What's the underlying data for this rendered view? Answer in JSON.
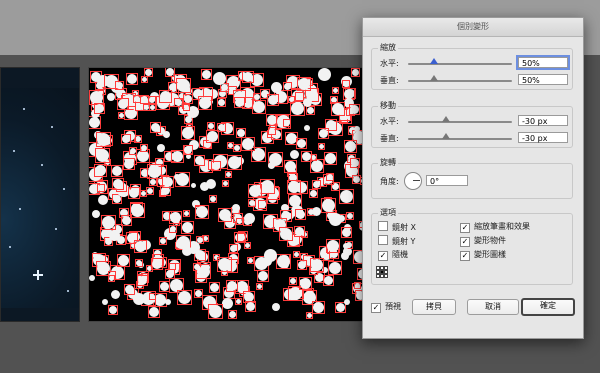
{
  "dialog": {
    "title": "個別變形",
    "scale": {
      "label": "縮放",
      "horizontal_label": "水平:",
      "horizontal_value": "50%",
      "vertical_label": "垂直:",
      "vertical_value": "50%"
    },
    "move": {
      "label": "移動",
      "horizontal_label": "水平:",
      "horizontal_value": "-30 px",
      "vertical_label": "垂直:",
      "vertical_value": "-30 px"
    },
    "rotate": {
      "label": "旋轉",
      "angle_label": "角度:",
      "angle_value": "0°"
    },
    "options": {
      "label": "選項",
      "reflect_x": {
        "label": "鏡射 X",
        "checked": false
      },
      "reflect_y": {
        "label": "鏡射 Y",
        "checked": false
      },
      "random": {
        "label": "隨機",
        "checked": true
      },
      "scale_strokes": {
        "label": "縮放筆畫和效果",
        "checked": true
      },
      "transform_objects": {
        "label": "變形物件",
        "checked": true
      },
      "transform_patterns": {
        "label": "變形圖樣",
        "checked": true
      }
    },
    "preview": {
      "label": "預視",
      "checked": true
    },
    "buttons": {
      "copy": "拷貝",
      "cancel": "取消",
      "ok": "確定"
    }
  },
  "colors": {
    "selection": "#ff3a3a",
    "dialog_bg": "#e6e6e6",
    "canvas_bg": "#525252"
  },
  "icons": {
    "checkmark": "check-icon",
    "reference_point": "reference-point-icon",
    "angle_dial": "angle-dial-icon"
  }
}
